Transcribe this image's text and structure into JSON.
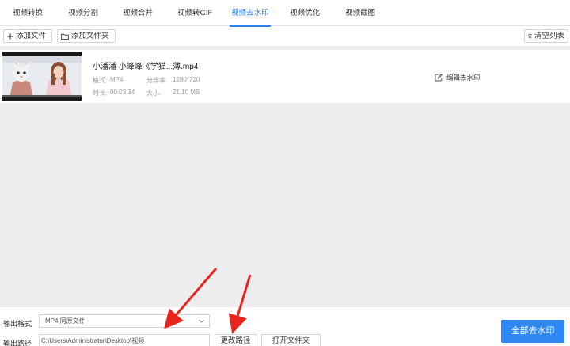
{
  "tabs": [
    {
      "label": "视频转换"
    },
    {
      "label": "视频分割"
    },
    {
      "label": "视频合并"
    },
    {
      "label": "视频转GIF"
    },
    {
      "label": "视频去水印"
    },
    {
      "label": "视频优化"
    },
    {
      "label": "视频截图"
    }
  ],
  "active_tab": "视频去水印",
  "toolbar": {
    "add_file": "添加文件",
    "add_folder": "添加文件夹",
    "clear_list": "清空列表"
  },
  "file": {
    "name": "小潘潘 小峰峰《学猫...薄.mp4",
    "format_label": "格式:",
    "format_value": "MP4",
    "resolution_label": "分辨率:",
    "resolution_value": "1280*720",
    "duration_label": "时长:",
    "duration_value": "00:03:34",
    "size_label": "大小:",
    "size_value": "21.10 MB",
    "edit_action": "编辑去水印"
  },
  "output": {
    "format_label": "输出格式",
    "format_value": "MP4  同原文件",
    "path_label": "输出路径",
    "path_value": "C:\\Users\\Administrator\\Desktop\\视频",
    "change_path": "更改路径",
    "open_folder": "打开文件夹",
    "remove_all": "全部去水印"
  },
  "colors": {
    "accent": "#2f7ff0",
    "primary_button": "#2f88f2",
    "annotation_arrow": "#e8241c",
    "list_background": "#ededf0"
  },
  "icons": {
    "add": "plus-icon",
    "folder": "folder-icon",
    "trash": "trash-icon",
    "edit": "edit-icon",
    "dropdown": "chevron-down-icon"
  }
}
